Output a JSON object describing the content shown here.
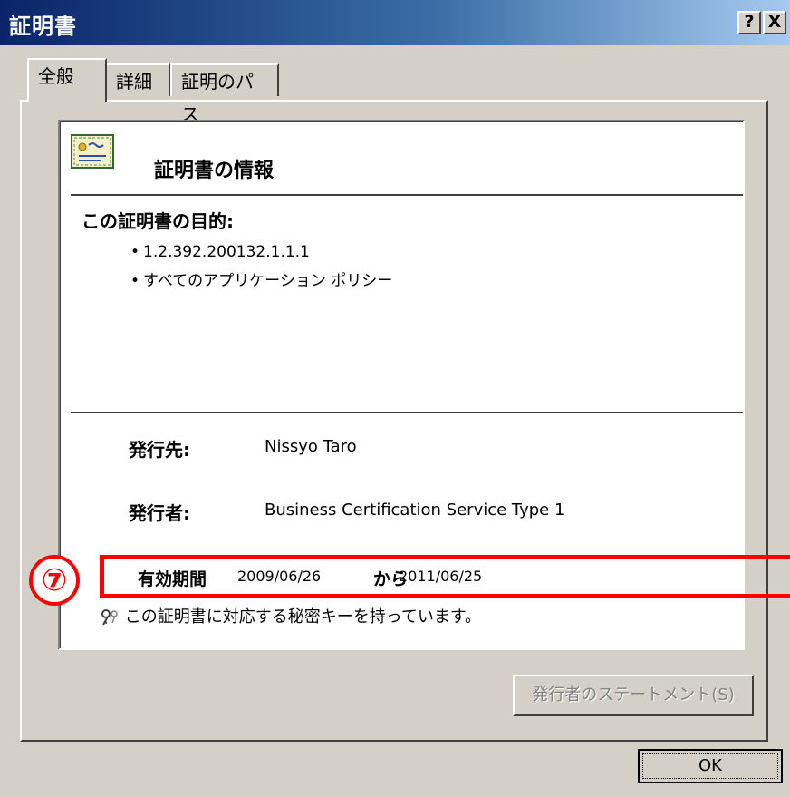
{
  "window": {
    "title": "証明書",
    "help_label": "?",
    "close_label": "X"
  },
  "tabs": [
    {
      "label": "全般",
      "active": true
    },
    {
      "label": "詳細",
      "active": false
    },
    {
      "label": "証明のパス",
      "active": false
    }
  ],
  "info": {
    "title": "証明書の情報",
    "icon": "certificate-icon",
    "purpose_heading": "この証明書の目的:",
    "purposes": [
      "1.2.392.200132.1.1.1",
      "すべてのアプリケーション ポリシー"
    ],
    "issued_to_label": "発行先:",
    "issued_to_value": "Nissyo Taro",
    "issued_by_label": "発行者:",
    "issued_by_value": "Business Certification Service Type 1",
    "validity_label": "有効期間",
    "valid_from": "2009/06/26",
    "from_to_word": "から",
    "valid_to": "2011/06/25",
    "private_key_text": "この証明書に対応する秘密キーを持っています。",
    "key_icon": "key-icon"
  },
  "annotation": {
    "marker": "⑦",
    "color": "#ff0000"
  },
  "buttons": {
    "statement_label": "発行者のステートメント(S)",
    "ok_label": "OK"
  }
}
